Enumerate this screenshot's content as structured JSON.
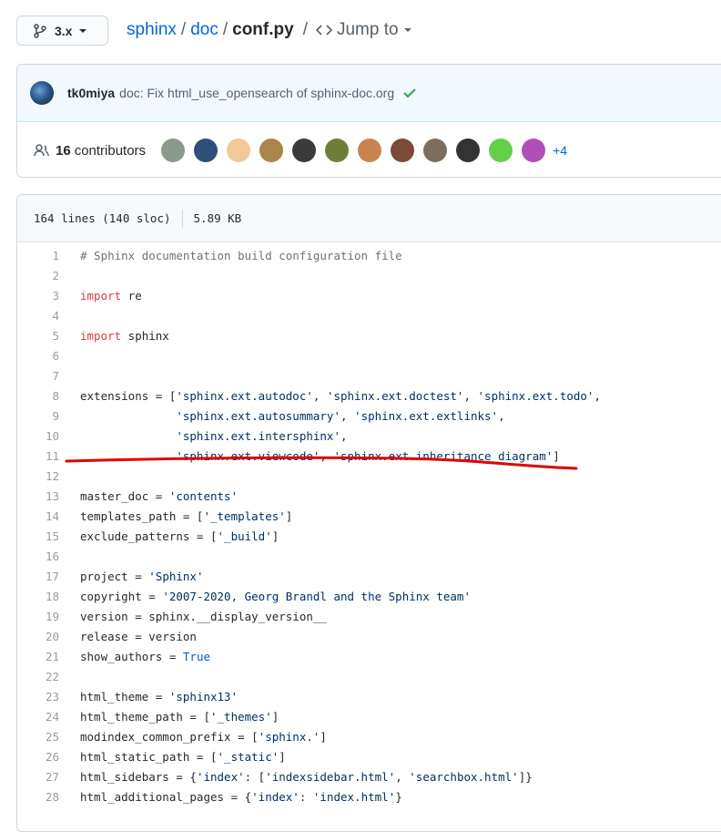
{
  "branch": {
    "label": "3.x"
  },
  "breadcrumb": {
    "repo": "sphinx",
    "sep": "/",
    "dir": "doc",
    "file": "conf.py",
    "jump": "Jump to"
  },
  "commit": {
    "author": "tk0miya",
    "message": "doc: Fix html_use_opensearch of sphinx-doc.org",
    "status": "success"
  },
  "contributors": {
    "count": "16",
    "label": "contributors",
    "more": "+4",
    "avatar_colors": [
      "#8a9a8c",
      "#2d4f78",
      "#f0c89a",
      "#a8854a",
      "#3a3a3a",
      "#6f7f3a",
      "#c8844f",
      "#7a4a3a",
      "#7d6e5e",
      "#333333",
      "#64d04a",
      "#b04fb8"
    ]
  },
  "file": {
    "lines_info": "164 lines (140 sloc)",
    "size": "5.89 KB"
  },
  "colors": {
    "annotation": "#e00000",
    "link": "#0366d6",
    "keyword": "#d73a49",
    "string": "#032f62"
  },
  "code_lines": [
    [
      {
        "t": "# Sphinx documentation build configuration file",
        "c": "cm"
      }
    ],
    [],
    [
      {
        "t": "import",
        "c": "kw"
      },
      {
        "t": " re"
      }
    ],
    [],
    [
      {
        "t": "import",
        "c": "kw"
      },
      {
        "t": " sphinx"
      }
    ],
    [],
    [],
    [
      {
        "t": "extensions = ["
      },
      {
        "t": "'sphinx.ext.autodoc'",
        "c": "str"
      },
      {
        "t": ", "
      },
      {
        "t": "'sphinx.ext.doctest'",
        "c": "str"
      },
      {
        "t": ", "
      },
      {
        "t": "'sphinx.ext.todo'",
        "c": "str"
      },
      {
        "t": ","
      }
    ],
    [
      {
        "t": "              "
      },
      {
        "t": "'sphinx.ext.autosummary'",
        "c": "str"
      },
      {
        "t": ", "
      },
      {
        "t": "'sphinx.ext.extlinks'",
        "c": "str"
      },
      {
        "t": ","
      }
    ],
    [
      {
        "t": "              "
      },
      {
        "t": "'sphinx.ext.intersphinx'",
        "c": "str"
      },
      {
        "t": ","
      }
    ],
    [
      {
        "t": "              "
      },
      {
        "t": "'sphinx.ext.viewcode'",
        "c": "str"
      },
      {
        "t": ", "
      },
      {
        "t": "'sphinx.ext.inheritance_diagram'",
        "c": "str"
      },
      {
        "t": "]"
      }
    ],
    [],
    [
      {
        "t": "master_doc = "
      },
      {
        "t": "'contents'",
        "c": "str"
      }
    ],
    [
      {
        "t": "templates_path = ["
      },
      {
        "t": "'_templates'",
        "c": "str"
      },
      {
        "t": "]"
      }
    ],
    [
      {
        "t": "exclude_patterns = ["
      },
      {
        "t": "'_build'",
        "c": "str"
      },
      {
        "t": "]"
      }
    ],
    [],
    [
      {
        "t": "project = "
      },
      {
        "t": "'Sphinx'",
        "c": "str"
      }
    ],
    [
      {
        "t": "copyright = "
      },
      {
        "t": "'2007-2020, Georg Brandl and the Sphinx team'",
        "c": "str"
      }
    ],
    [
      {
        "t": "version = sphinx.__display_version__"
      }
    ],
    [
      {
        "t": "release = version"
      }
    ],
    [
      {
        "t": "show_authors = "
      },
      {
        "t": "True",
        "c": "const"
      }
    ],
    [],
    [
      {
        "t": "html_theme = "
      },
      {
        "t": "'sphinx13'",
        "c": "str"
      }
    ],
    [
      {
        "t": "html_theme_path = ["
      },
      {
        "t": "'_themes'",
        "c": "str"
      },
      {
        "t": "]"
      }
    ],
    [
      {
        "t": "modindex_common_prefix = ["
      },
      {
        "t": "'sphinx.'",
        "c": "str"
      },
      {
        "t": "]"
      }
    ],
    [
      {
        "t": "html_static_path = ["
      },
      {
        "t": "'_static'",
        "c": "str"
      },
      {
        "t": "]"
      }
    ],
    [
      {
        "t": "html_sidebars = {"
      },
      {
        "t": "'index'",
        "c": "str"
      },
      {
        "t": ": ["
      },
      {
        "t": "'indexsidebar.html'",
        "c": "str"
      },
      {
        "t": ", "
      },
      {
        "t": "'searchbox.html'",
        "c": "str"
      },
      {
        "t": "]}"
      }
    ],
    [
      {
        "t": "html_additional_pages = {"
      },
      {
        "t": "'index'",
        "c": "str"
      },
      {
        "t": ": "
      },
      {
        "t": "'index.html'",
        "c": "str"
      },
      {
        "t": "}"
      }
    ]
  ]
}
